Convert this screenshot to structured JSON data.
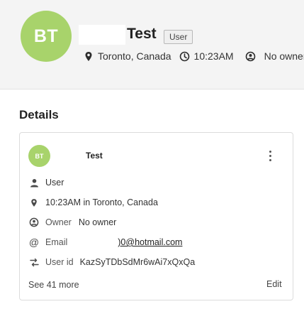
{
  "header": {
    "avatar_initials": "BT",
    "name": "Test",
    "role_badge": "User",
    "location": "Toronto, Canada",
    "local_time": "10:23AM",
    "owner_status": "No owner",
    "avatar_color": "#a8d36b"
  },
  "details": {
    "title": "Details",
    "card": {
      "avatar_initials": "BT",
      "name": "Test",
      "role": "User",
      "time_location": "10:23AM in Toronto, Canada",
      "owner_label": "Owner",
      "owner_value": "No owner",
      "email_label": "Email",
      "email_value": ")0@hotmail.com",
      "userid_label": "User id",
      "userid_value": "KazSyTDbSdMr6wAi7xQxQa",
      "see_more": "See 41 more",
      "edit": "Edit"
    }
  },
  "icons": {
    "location": "location-pin-icon",
    "time": "clock-icon",
    "owner": "owner-icon",
    "person": "person-icon",
    "email": "at-sign-icon",
    "userid": "shuffle-icon",
    "menu": "kebab-menu-icon"
  }
}
